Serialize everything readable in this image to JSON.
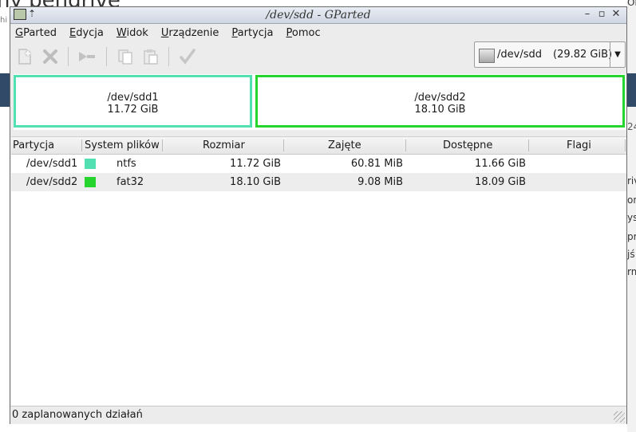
{
  "background": {
    "title": "ny pendrive",
    "hint": "hi",
    "right_fragments": [
      "Obcz",
      "24",
      "riv",
      "on",
      "ys",
      "pr",
      "jś",
      "rm"
    ]
  },
  "window": {
    "title": "/dev/sdd - GParted",
    "controls": [
      "–",
      "▫",
      "✕"
    ]
  },
  "menu": [
    {
      "acc": "G",
      "rest": "Parted"
    },
    {
      "acc": "E",
      "rest": "dycja"
    },
    {
      "acc": "W",
      "rest": "idok"
    },
    {
      "acc": "U",
      "rest": "rządzenie"
    },
    {
      "acc": "P",
      "rest": "artycja"
    },
    {
      "acc": "P",
      "rest": "omoc"
    }
  ],
  "toolbar": {
    "icons": [
      "new-icon",
      "delete-icon",
      "resize-move-icon",
      "copy-icon",
      "paste-icon",
      "apply-icon"
    ]
  },
  "device": {
    "name": "/dev/sdd",
    "size": "(29.82 GiB)"
  },
  "partitions_visual": [
    {
      "name": "/dev/sdd1",
      "size": "11.72 GiB",
      "color": "#52e0b2"
    },
    {
      "name": "/dev/sdd2",
      "size": "18.10 GiB",
      "color": "#26d42e"
    }
  ],
  "table": {
    "headers": [
      "Partycja",
      "System plików",
      "Rozmiar",
      "Zajęte",
      "Dostępne",
      "Flagi"
    ],
    "rows": [
      {
        "partition": "/dev/sdd1",
        "fs": "ntfs",
        "fs_color": "#52e0b2",
        "size": "11.72 GiB",
        "used": "60.81 MiB",
        "free": "11.66 GiB",
        "flags": ""
      },
      {
        "partition": "/dev/sdd2",
        "fs": "fat32",
        "fs_color": "#26d42e",
        "size": "18.10 GiB",
        "used": "9.08 MiB",
        "free": "18.09 GiB",
        "flags": ""
      }
    ]
  },
  "status": "0 zaplanowanych działań"
}
